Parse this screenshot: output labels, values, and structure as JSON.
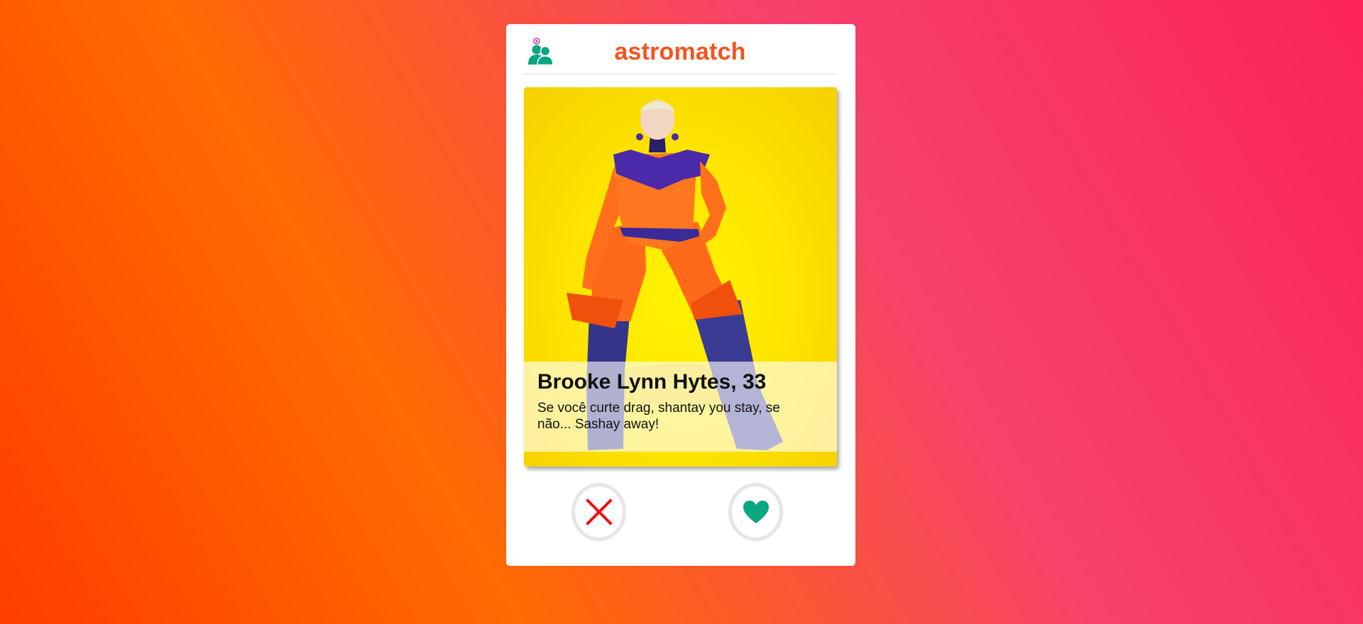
{
  "header": {
    "title": "astromatch",
    "matches_icon": "people-icon",
    "accent_color": "#f4541f",
    "icon_color": "#0aa680"
  },
  "profile": {
    "name_age": "Brooke Lynn Hytes, 33",
    "bio": "Se você curte drag, shantay you stay, se não... Sashay away!",
    "photo_icon": "profile-photo"
  },
  "actions": {
    "reject_icon": "close-icon",
    "reject_color": "#ee1111",
    "like_icon": "heart-icon",
    "like_color": "#0aa680"
  }
}
